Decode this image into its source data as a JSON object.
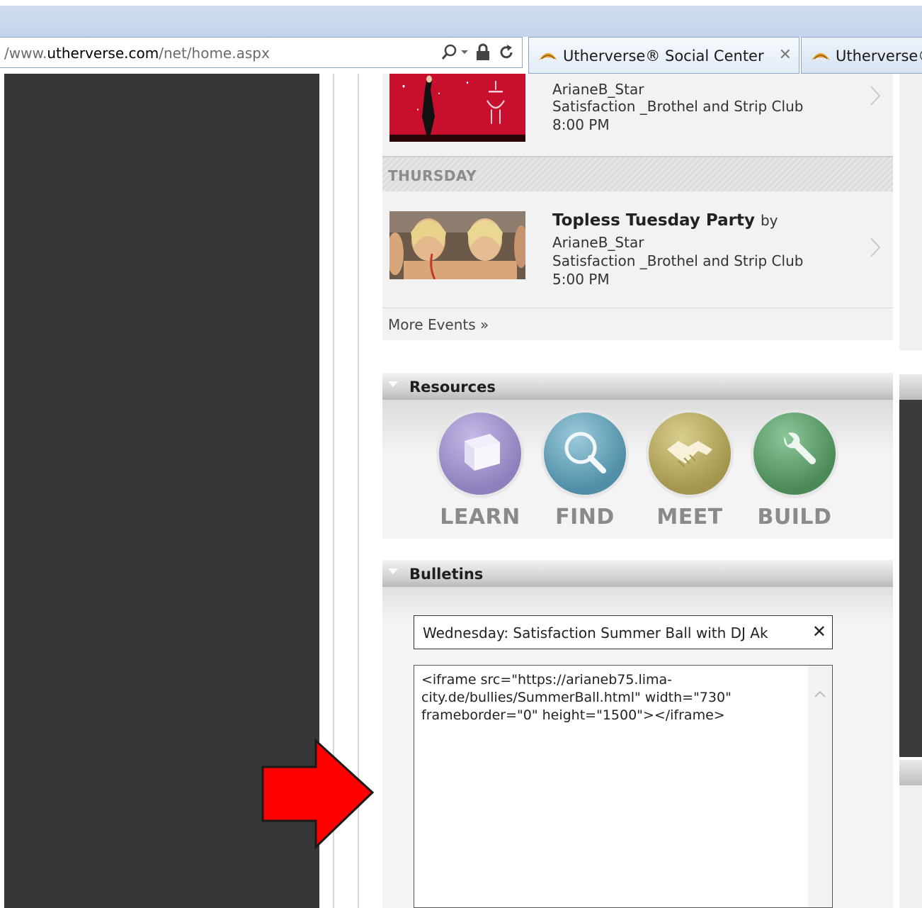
{
  "browser": {
    "url_prefix": "/www.",
    "url_domain": "utherverse.com",
    "url_path": "/net/home.aspx",
    "tabs": [
      {
        "label": "Utherverse® Social Center",
        "close": "✕"
      },
      {
        "label": "Utherverse®"
      }
    ]
  },
  "events": {
    "items": [
      {
        "host": "ArianeB_Star",
        "location": "Satisfaction _Brothel and Strip Club",
        "time": "8:00 PM"
      },
      {
        "title": "Topless Tuesday Party",
        "by": "by",
        "host": "ArianeB_Star",
        "location": "Satisfaction _Brothel and Strip Club",
        "time": "5:00 PM"
      }
    ],
    "day": "THURSDAY",
    "more": "More Events »"
  },
  "resources": {
    "title": "Resources",
    "items": [
      {
        "label": "LEARN",
        "icon": "book-icon",
        "color": "#9a8bc4"
      },
      {
        "label": "FIND",
        "icon": "magnifier-icon",
        "color": "#5b9bb0"
      },
      {
        "label": "MEET",
        "icon": "handshake-icon",
        "color": "#b3a65a"
      },
      {
        "label": "BUILD",
        "icon": "wrench-icon",
        "color": "#5a9a62"
      }
    ]
  },
  "bulletins": {
    "title": "Bulletins",
    "subject": "Wednesday: Satisfaction Summer Ball with DJ Ak",
    "close": "✕",
    "body": "<iframe src=\"https://arianeb75.lima-city.de/bullies/SummerBall.html\" width=\"730\" frameborder=\"0\" height=\"1500\"></iframe>"
  },
  "annotation": {
    "icon": "red-arrow-icon",
    "color": "#ff0000"
  }
}
